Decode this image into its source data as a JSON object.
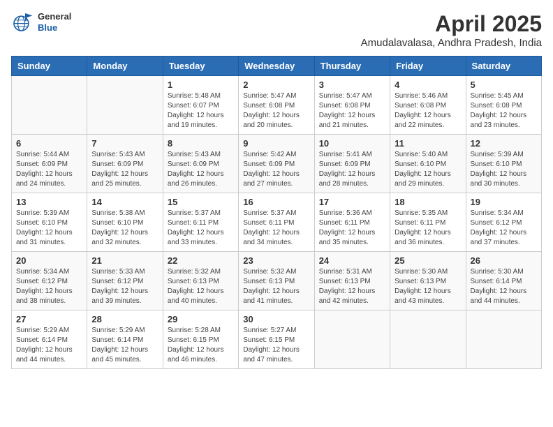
{
  "header": {
    "logo_general": "General",
    "logo_blue": "Blue",
    "month_title": "April 2025",
    "location": "Amudalavalasa, Andhra Pradesh, India"
  },
  "weekdays": [
    "Sunday",
    "Monday",
    "Tuesday",
    "Wednesday",
    "Thursday",
    "Friday",
    "Saturday"
  ],
  "weeks": [
    [
      {
        "day": "",
        "info": ""
      },
      {
        "day": "",
        "info": ""
      },
      {
        "day": "1",
        "info": "Sunrise: 5:48 AM\nSunset: 6:07 PM\nDaylight: 12 hours and 19 minutes."
      },
      {
        "day": "2",
        "info": "Sunrise: 5:47 AM\nSunset: 6:08 PM\nDaylight: 12 hours and 20 minutes."
      },
      {
        "day": "3",
        "info": "Sunrise: 5:47 AM\nSunset: 6:08 PM\nDaylight: 12 hours and 21 minutes."
      },
      {
        "day": "4",
        "info": "Sunrise: 5:46 AM\nSunset: 6:08 PM\nDaylight: 12 hours and 22 minutes."
      },
      {
        "day": "5",
        "info": "Sunrise: 5:45 AM\nSunset: 6:08 PM\nDaylight: 12 hours and 23 minutes."
      }
    ],
    [
      {
        "day": "6",
        "info": "Sunrise: 5:44 AM\nSunset: 6:09 PM\nDaylight: 12 hours and 24 minutes."
      },
      {
        "day": "7",
        "info": "Sunrise: 5:43 AM\nSunset: 6:09 PM\nDaylight: 12 hours and 25 minutes."
      },
      {
        "day": "8",
        "info": "Sunrise: 5:43 AM\nSunset: 6:09 PM\nDaylight: 12 hours and 26 minutes."
      },
      {
        "day": "9",
        "info": "Sunrise: 5:42 AM\nSunset: 6:09 PM\nDaylight: 12 hours and 27 minutes."
      },
      {
        "day": "10",
        "info": "Sunrise: 5:41 AM\nSunset: 6:09 PM\nDaylight: 12 hours and 28 minutes."
      },
      {
        "day": "11",
        "info": "Sunrise: 5:40 AM\nSunset: 6:10 PM\nDaylight: 12 hours and 29 minutes."
      },
      {
        "day": "12",
        "info": "Sunrise: 5:39 AM\nSunset: 6:10 PM\nDaylight: 12 hours and 30 minutes."
      }
    ],
    [
      {
        "day": "13",
        "info": "Sunrise: 5:39 AM\nSunset: 6:10 PM\nDaylight: 12 hours and 31 minutes."
      },
      {
        "day": "14",
        "info": "Sunrise: 5:38 AM\nSunset: 6:10 PM\nDaylight: 12 hours and 32 minutes."
      },
      {
        "day": "15",
        "info": "Sunrise: 5:37 AM\nSunset: 6:11 PM\nDaylight: 12 hours and 33 minutes."
      },
      {
        "day": "16",
        "info": "Sunrise: 5:37 AM\nSunset: 6:11 PM\nDaylight: 12 hours and 34 minutes."
      },
      {
        "day": "17",
        "info": "Sunrise: 5:36 AM\nSunset: 6:11 PM\nDaylight: 12 hours and 35 minutes."
      },
      {
        "day": "18",
        "info": "Sunrise: 5:35 AM\nSunset: 6:11 PM\nDaylight: 12 hours and 36 minutes."
      },
      {
        "day": "19",
        "info": "Sunrise: 5:34 AM\nSunset: 6:12 PM\nDaylight: 12 hours and 37 minutes."
      }
    ],
    [
      {
        "day": "20",
        "info": "Sunrise: 5:34 AM\nSunset: 6:12 PM\nDaylight: 12 hours and 38 minutes."
      },
      {
        "day": "21",
        "info": "Sunrise: 5:33 AM\nSunset: 6:12 PM\nDaylight: 12 hours and 39 minutes."
      },
      {
        "day": "22",
        "info": "Sunrise: 5:32 AM\nSunset: 6:13 PM\nDaylight: 12 hours and 40 minutes."
      },
      {
        "day": "23",
        "info": "Sunrise: 5:32 AM\nSunset: 6:13 PM\nDaylight: 12 hours and 41 minutes."
      },
      {
        "day": "24",
        "info": "Sunrise: 5:31 AM\nSunset: 6:13 PM\nDaylight: 12 hours and 42 minutes."
      },
      {
        "day": "25",
        "info": "Sunrise: 5:30 AM\nSunset: 6:13 PM\nDaylight: 12 hours and 43 minutes."
      },
      {
        "day": "26",
        "info": "Sunrise: 5:30 AM\nSunset: 6:14 PM\nDaylight: 12 hours and 44 minutes."
      }
    ],
    [
      {
        "day": "27",
        "info": "Sunrise: 5:29 AM\nSunset: 6:14 PM\nDaylight: 12 hours and 44 minutes."
      },
      {
        "day": "28",
        "info": "Sunrise: 5:29 AM\nSunset: 6:14 PM\nDaylight: 12 hours and 45 minutes."
      },
      {
        "day": "29",
        "info": "Sunrise: 5:28 AM\nSunset: 6:15 PM\nDaylight: 12 hours and 46 minutes."
      },
      {
        "day": "30",
        "info": "Sunrise: 5:27 AM\nSunset: 6:15 PM\nDaylight: 12 hours and 47 minutes."
      },
      {
        "day": "",
        "info": ""
      },
      {
        "day": "",
        "info": ""
      },
      {
        "day": "",
        "info": ""
      }
    ]
  ]
}
